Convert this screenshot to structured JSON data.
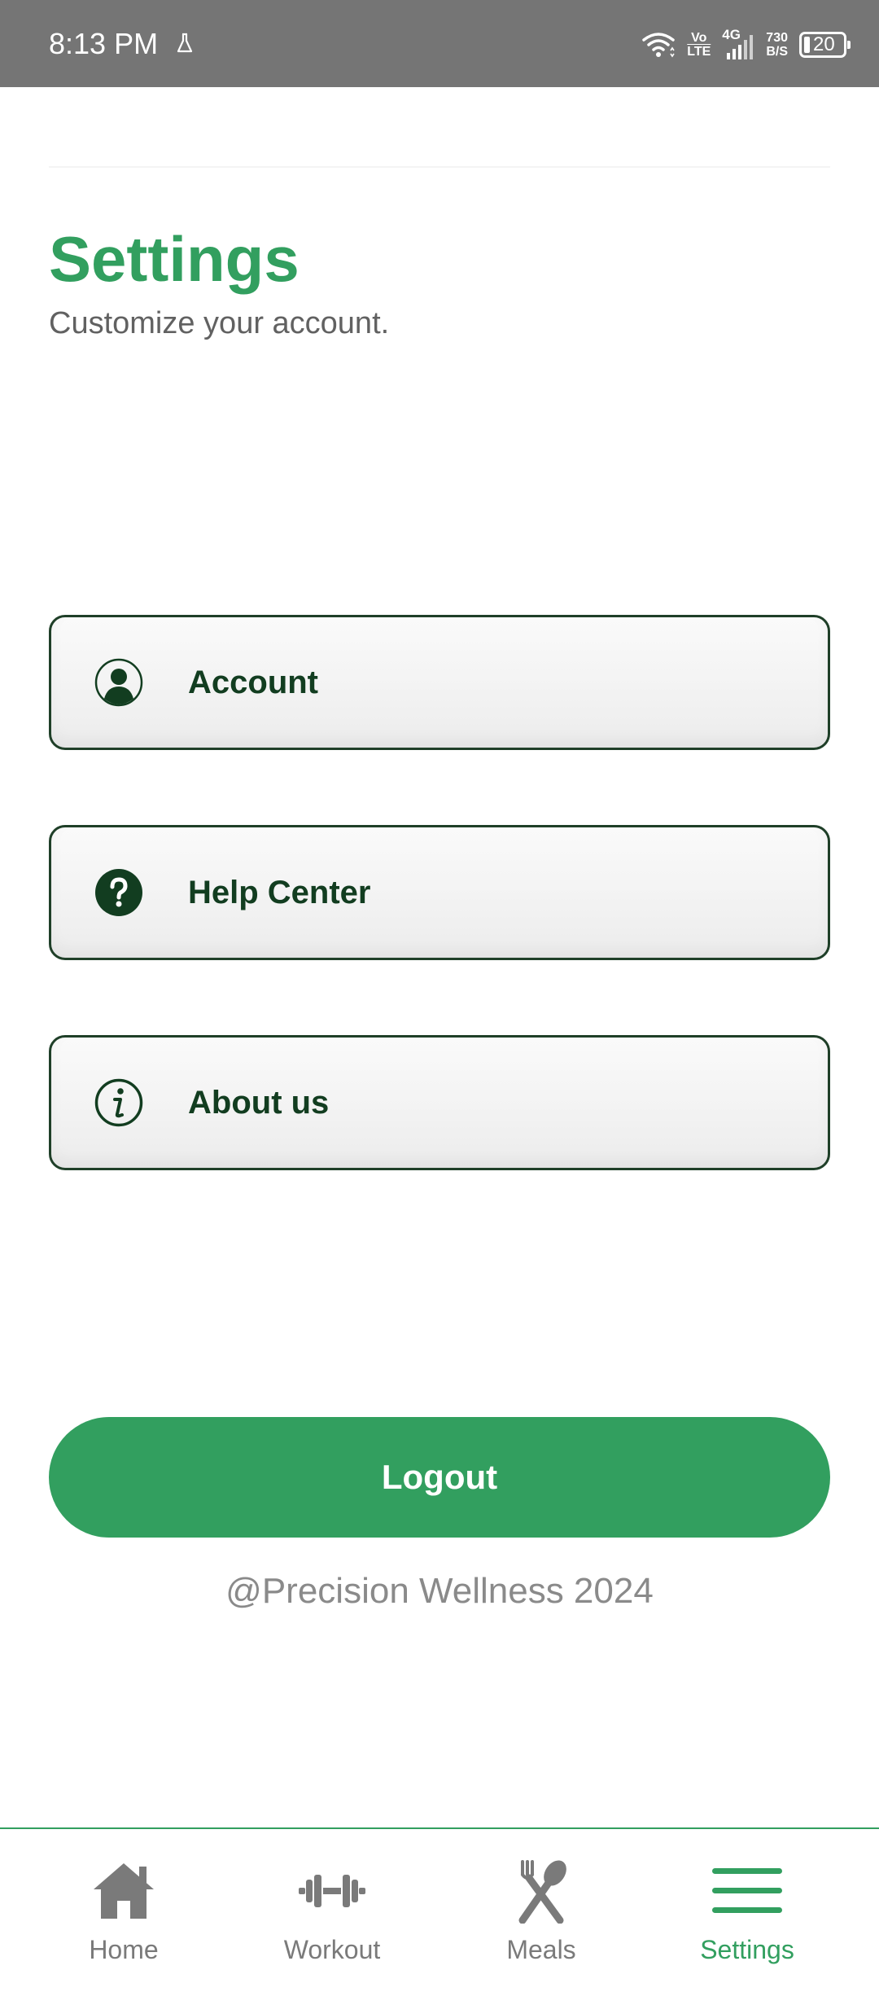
{
  "status_bar": {
    "time": "8:13 PM",
    "volte_top": "Vo",
    "volte_bottom": "LTE",
    "network": "4G",
    "speed_value": "730",
    "speed_unit": "B/S",
    "battery": "20"
  },
  "header": {
    "title": "Settings",
    "subtitle": "Customize your account."
  },
  "menu": {
    "items": [
      {
        "label": "Account",
        "icon": "account-circle-icon"
      },
      {
        "label": "Help Center",
        "icon": "help-icon"
      },
      {
        "label": "About us",
        "icon": "info-icon"
      }
    ]
  },
  "logout": {
    "label": "Logout"
  },
  "footer": {
    "copyright": "@Precision Wellness 2024"
  },
  "bottom_nav": {
    "items": [
      {
        "label": "Home",
        "icon": "home-icon",
        "active": false
      },
      {
        "label": "Workout",
        "icon": "dumbbell-icon",
        "active": false
      },
      {
        "label": "Meals",
        "icon": "fork-spoon-icon",
        "active": false
      },
      {
        "label": "Settings",
        "icon": "menu-icon",
        "active": true
      }
    ]
  },
  "colors": {
    "accent": "#329f5f",
    "dark_green": "#123d20",
    "status_bar": "#757575",
    "nav_inactive": "#7a7a7a"
  }
}
